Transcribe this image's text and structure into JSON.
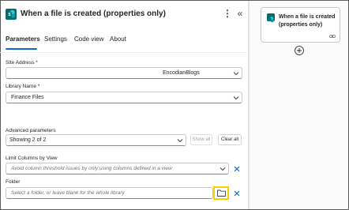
{
  "header": {
    "title": "When a file is created (properties only)",
    "more_icon": "more-vertical-icon",
    "collapse_icon": "double-chevron-left-icon",
    "app_icon": "sharepoint-icon",
    "accent": "#036c70"
  },
  "tabs": [
    {
      "label": "Parameters",
      "active": true
    },
    {
      "label": "Settings",
      "active": false
    },
    {
      "label": "Code view",
      "active": false
    },
    {
      "label": "About",
      "active": false
    }
  ],
  "site_address": {
    "label": "Site Address *",
    "value": "EncodianBlogs"
  },
  "library_name": {
    "label": "Library Name *",
    "value": "Finance Files"
  },
  "advanced": {
    "label": "Advanced parameters",
    "value": "Showing 2 of 2",
    "show_all": "Show all",
    "clear_all": "Clear all"
  },
  "limit_columns": {
    "label": "Limit Columns by View",
    "placeholder": "Avoid column threshold issues by only using columns defined in a view"
  },
  "folder": {
    "label": "Folder",
    "placeholder": "Select a folder, or leave blank for the whole library",
    "highlight_color": "#f2d300"
  },
  "canvas": {
    "card_title": "When a file is created (properties only)",
    "link_icon": "link-icon",
    "add_icon": "plus-icon"
  },
  "colors": {
    "tab_underline": "#0f6cbd",
    "remove_icon": "#0f6cbd"
  }
}
